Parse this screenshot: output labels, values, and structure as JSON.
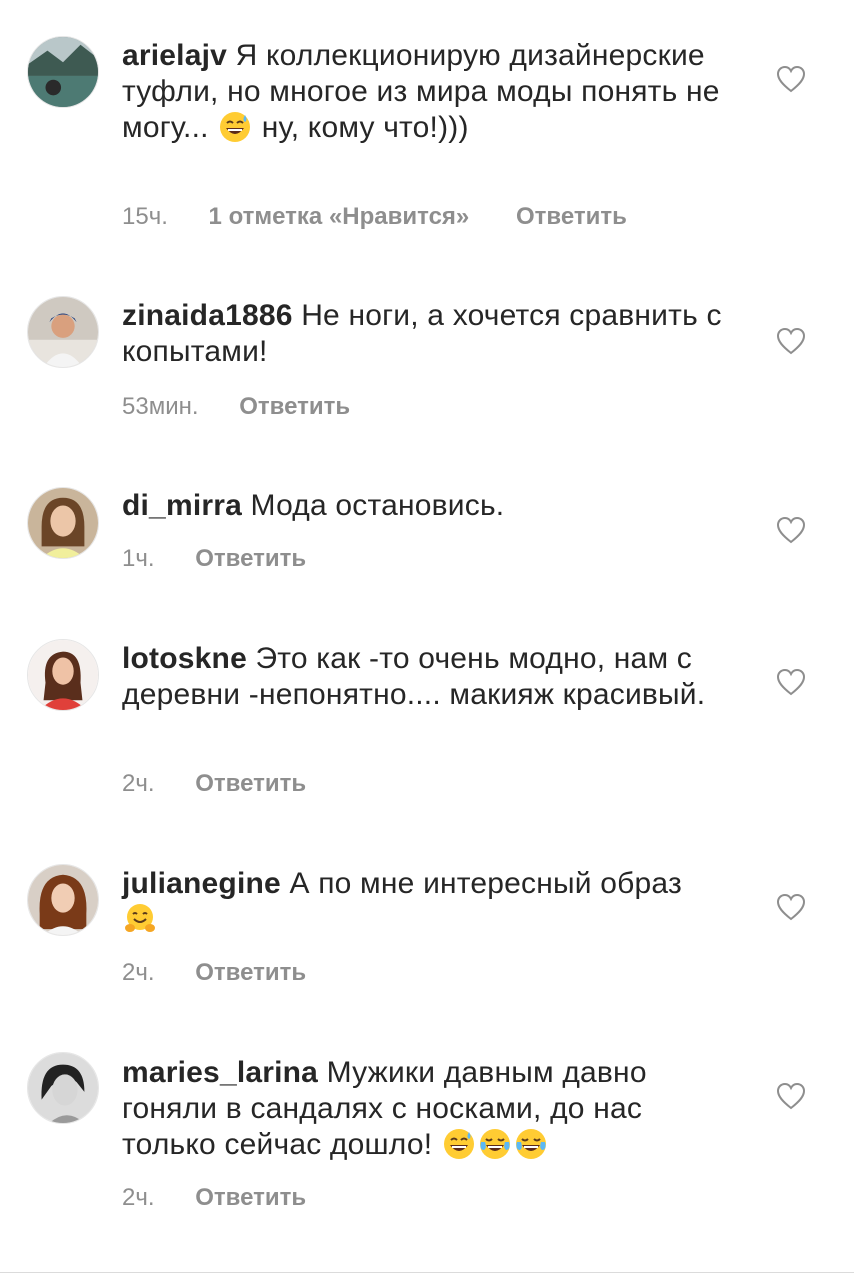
{
  "comments": [
    {
      "username": "arielajv",
      "text_before": "Я коллекционирую дизайнерские туфли, но многое из мира моды понять не могу...",
      "emoji": [
        "sweat-smile"
      ],
      "text_after": "ну, кому что!)))",
      "time": "15ч.",
      "likes": "1 отметка «Нравится»",
      "reply": "Ответить"
    },
    {
      "username": "zinaida1886",
      "text_before": "Не ноги, а хочется сравнить с копытами!",
      "emoji": [],
      "text_after": "",
      "time": "53мин.",
      "likes": "",
      "reply": "Ответить"
    },
    {
      "username": "di_mirra",
      "text_before": "Мода остановись.",
      "emoji": [],
      "text_after": "",
      "time": "1ч.",
      "likes": "",
      "reply": "Ответить"
    },
    {
      "username": "lotoskne",
      "text_before": "Это как -то очень модно, нам с деревни -непонятно.... макияж красивый.",
      "emoji": [],
      "text_after": "",
      "time": "2ч.",
      "likes": "",
      "reply": "Ответить"
    },
    {
      "username": "julianegine",
      "text_before": "А по мне интересный образ",
      "emoji": [
        "hugging-face"
      ],
      "text_after": "",
      "time": "2ч.",
      "likes": "",
      "reply": "Ответить"
    },
    {
      "username": "maries_larina",
      "text_before": "Мужики давным давно гоняли в сандалях с носками,  до нас только сейчас дошло!",
      "emoji": [
        "sweat-smile",
        "tears-of-joy",
        "tears-of-joy"
      ],
      "text_after": "",
      "time": "2ч.",
      "likes": "",
      "reply": "Ответить"
    }
  ],
  "icons": {
    "like": "heart-outline-icon",
    "avatar": "avatar"
  },
  "colors": {
    "text": "#262626",
    "meta": "#8e8e8e",
    "background": "#ffffff"
  }
}
